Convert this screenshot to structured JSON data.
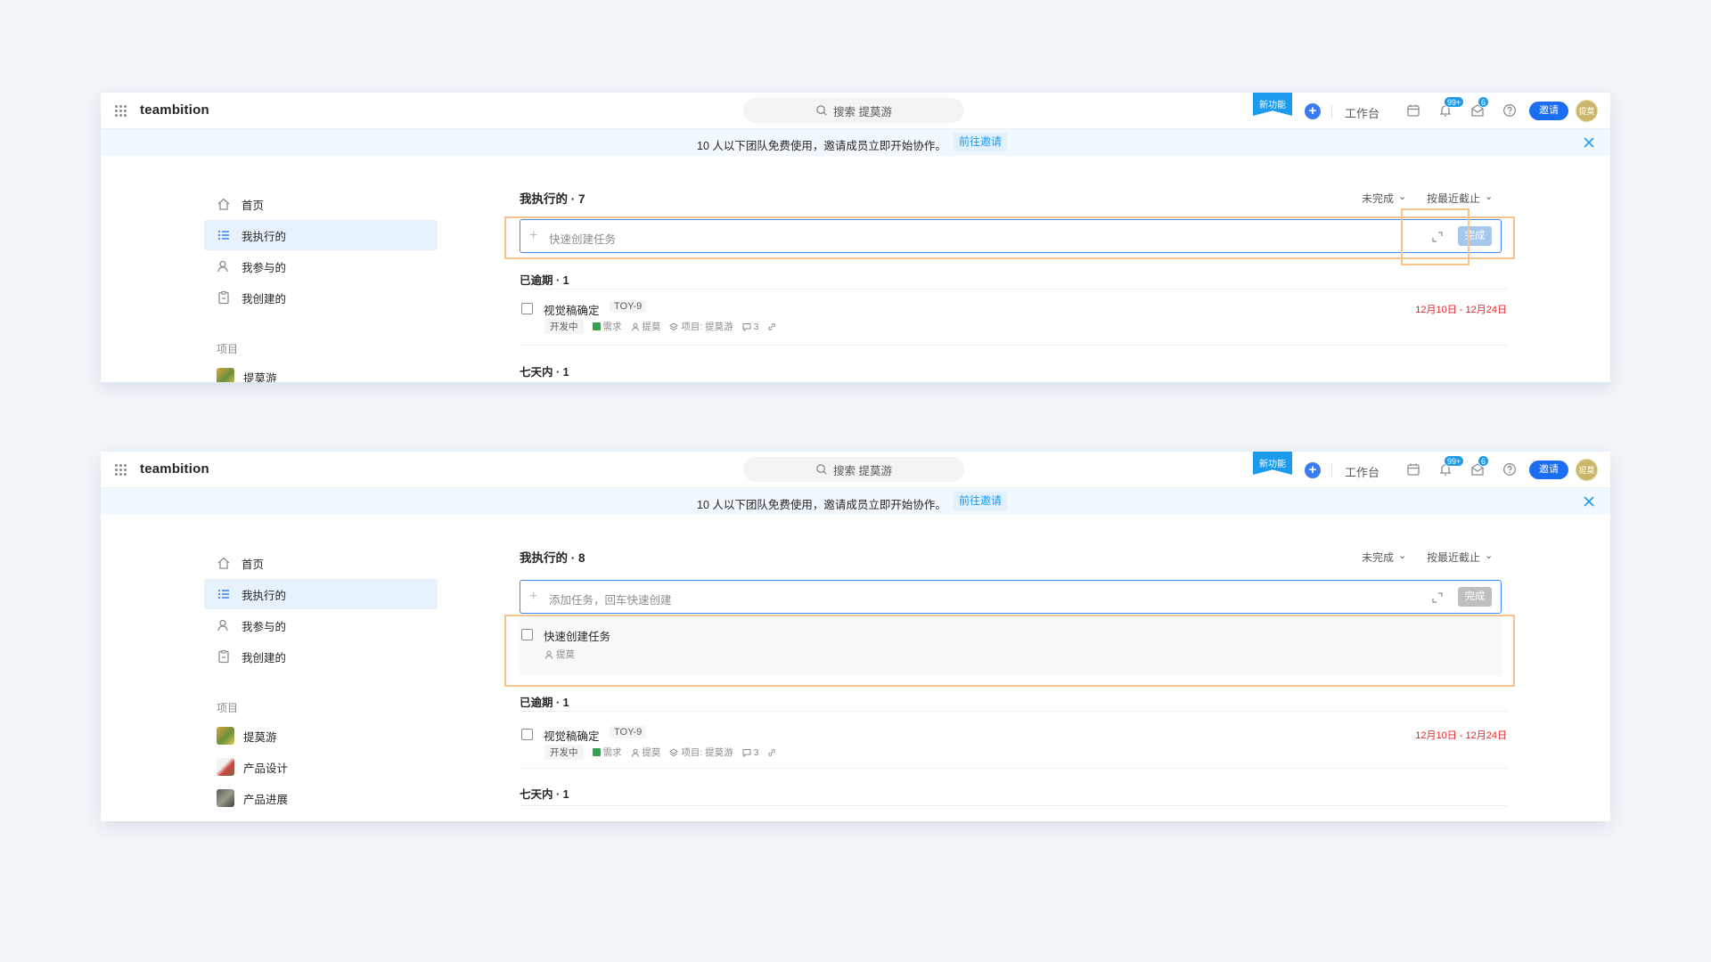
{
  "colors": {
    "accent": "#1b9aee",
    "primary": "#1b6ef0",
    "overdue": "#e5252a",
    "highlight": "#f5c48e",
    "page_bg": "#f1f6fa"
  },
  "screens": [
    {
      "topbar": {
        "logo": "teambition",
        "search_placeholder": "搜索 提莫游",
        "new_feature": "新功能",
        "workbench": "工作台",
        "notifications_badge": "99+",
        "messages_badge": "6",
        "invite_label": "邀请",
        "avatar_text": "提莫"
      },
      "banner": {
        "text": "10 人以下团队免费使用，邀请成员立即开始协作。",
        "link": "前往邀请"
      },
      "sidebar": {
        "items": [
          "首页",
          "我执行的",
          "我参与的",
          "我创建的"
        ],
        "projects_label": "项目",
        "projects": [
          "提莫游"
        ]
      },
      "main": {
        "title": "我执行的 · 7",
        "filter_status": "未完成",
        "filter_sort": "按最近截止",
        "quick_input_placeholder": "快速创建任务",
        "done_label": "完成",
        "groups": [
          {
            "title": "已逾期 · 1",
            "tasks": [
              {
                "name": "视觉稿确定",
                "id": "TOY-9",
                "status": "开发中",
                "type": "需求",
                "assignee": "提莫",
                "project": "项目: 提莫游",
                "comments": "3",
                "date": "12月10日 - 12月24日"
              }
            ]
          },
          {
            "title": "七天内 · 1",
            "tasks": []
          }
        ]
      }
    },
    {
      "topbar": {
        "logo": "teambition",
        "search_placeholder": "搜索 提莫游",
        "new_feature": "新功能",
        "workbench": "工作台",
        "notifications_badge": "99+",
        "messages_badge": "6",
        "invite_label": "邀请",
        "avatar_text": "提莫"
      },
      "banner": {
        "text": "10 人以下团队免费使用，邀请成员立即开始协作。",
        "link": "前往邀请"
      },
      "sidebar": {
        "items": [
          "首页",
          "我执行的",
          "我参与的",
          "我创建的"
        ],
        "projects_label": "项目",
        "projects": [
          "提莫游",
          "产品设计",
          "产品进展"
        ]
      },
      "main": {
        "title": "我执行的 · 8",
        "filter_status": "未完成",
        "filter_sort": "按最近截止",
        "quick_input_placeholder": "添加任务，回车快速创建",
        "done_label": "完成",
        "new_task": {
          "name": "快速创建任务",
          "assignee": "提莫"
        },
        "groups": [
          {
            "title": "已逾期 · 1",
            "tasks": [
              {
                "name": "视觉稿确定",
                "id": "TOY-9",
                "status": "开发中",
                "type": "需求",
                "assignee": "提莫",
                "project": "项目: 提莫游",
                "comments": "3",
                "date": "12月10日 - 12月24日"
              }
            ]
          },
          {
            "title": "七天内 · 1",
            "tasks": []
          }
        ]
      }
    }
  ]
}
